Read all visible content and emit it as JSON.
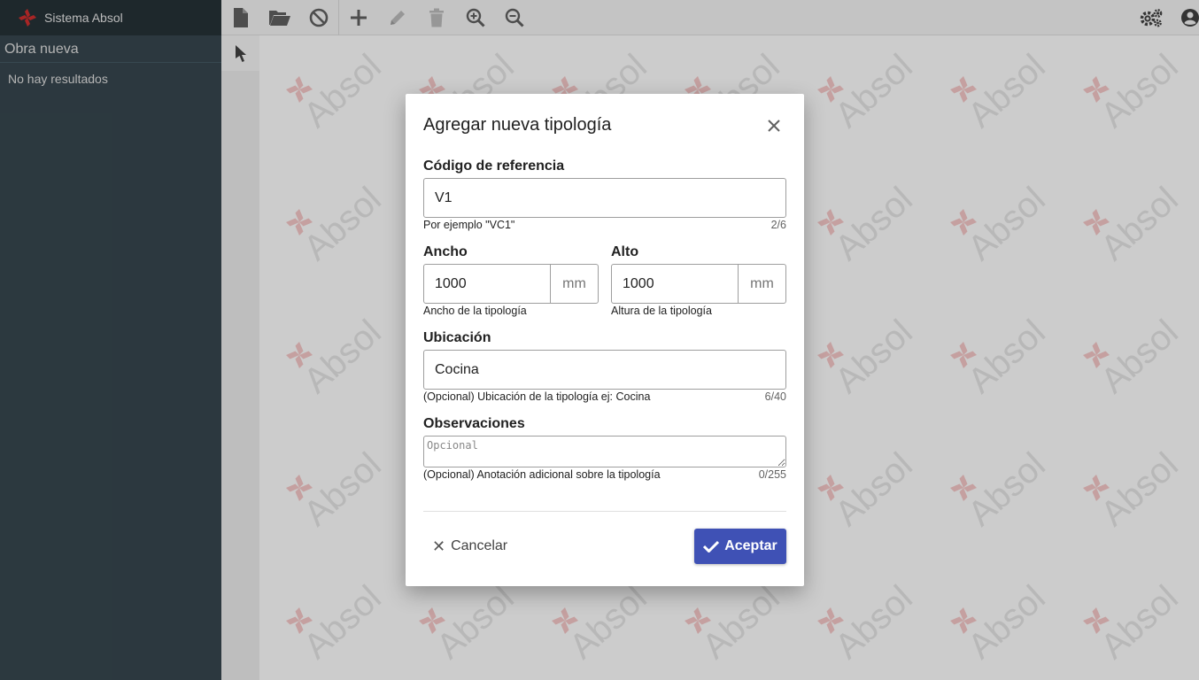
{
  "app": {
    "title": "Sistema Absol"
  },
  "sidebar": {
    "obra_title": "Obra nueva",
    "empty_text": "No hay resultados"
  },
  "toolbar": {
    "icons": [
      "new-file-icon",
      "open-folder-icon",
      "block-icon",
      "plus-icon",
      "pencil-icon",
      "trash-icon",
      "zoom-in-icon",
      "zoom-out-icon",
      "settings-icon",
      "account-icon"
    ]
  },
  "canvas": {
    "watermark_text": "Absol"
  },
  "dialog": {
    "title": "Agregar nueva tipología",
    "codigo": {
      "label": "Código de referencia",
      "value": "V1",
      "hint": "Por ejemplo \"VC1\"",
      "count": "2/6"
    },
    "ancho": {
      "label": "Ancho",
      "value": "1000",
      "unit": "mm",
      "hint": "Ancho de la tipología"
    },
    "alto": {
      "label": "Alto",
      "value": "1000",
      "unit": "mm",
      "hint": "Altura de la tipología"
    },
    "ubicacion": {
      "label": "Ubicación",
      "value": "Cocina",
      "hint": "(Opcional) Ubicación de la tipología ej: Cocina",
      "count": "6/40"
    },
    "observaciones": {
      "label": "Observaciones",
      "placeholder": "Opcional",
      "hint": "(Opcional) Anotación adicional sobre la tipología",
      "count": "0/255"
    },
    "cancel_label": "Cancelar",
    "accept_label": "Aceptar"
  },
  "colors": {
    "sidebar": "#37474f",
    "brand_bar": "#263238",
    "accent": "#3f51b5",
    "logo_red": "#d32f2f"
  }
}
